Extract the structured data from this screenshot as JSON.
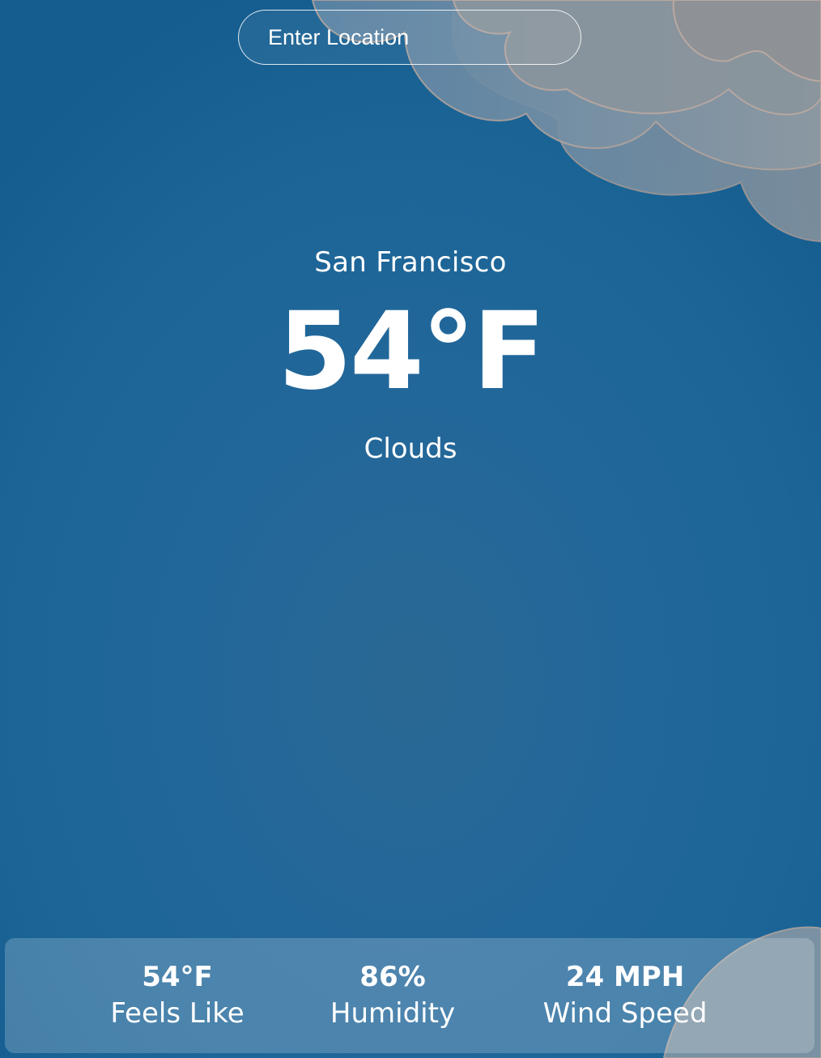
{
  "search": {
    "placeholder": "Enter Location"
  },
  "current": {
    "city": "San Francisco",
    "temperature": "54°F",
    "description": "Clouds"
  },
  "details": [
    {
      "value": "54°F",
      "label": "Feels Like"
    },
    {
      "value": "86%",
      "label": "Humidity"
    },
    {
      "value": "24 MPH",
      "label": "Wind Speed"
    }
  ],
  "colors": {
    "background": "#1e6596",
    "cloud": "#8a98a4",
    "cloud_outline": "#b9a8a0",
    "text": "#ffffff"
  },
  "icons": [
    "cloud-background-icon"
  ]
}
